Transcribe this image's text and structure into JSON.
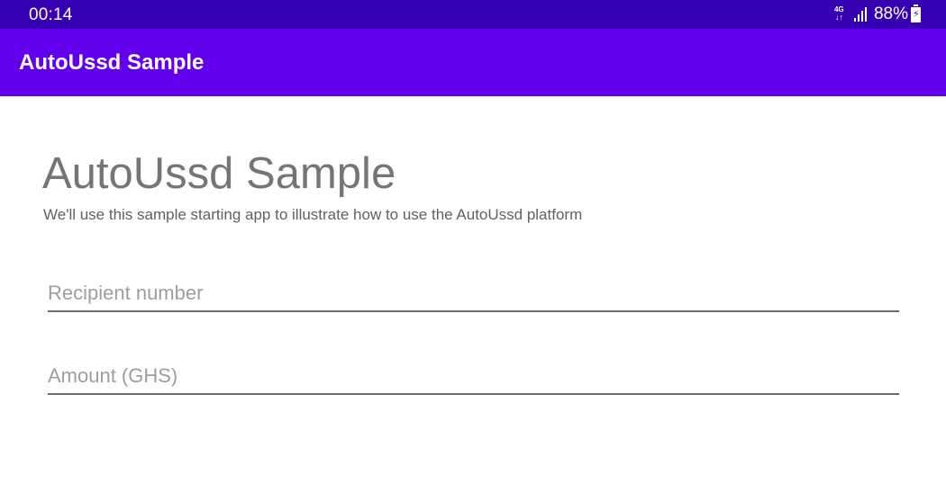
{
  "status_bar": {
    "time": "00:14",
    "network_type": "4G",
    "network_arrows": "↓↑",
    "battery_level": "88%",
    "icons": [
      "network-4g-icon",
      "signal-icon",
      "battery-charging-icon"
    ]
  },
  "app_bar": {
    "title": "AutoUssd Sample"
  },
  "main": {
    "title": "AutoUssd Sample",
    "subtitle": "We'll use this sample starting app to illustrate how to use the AutoUssd platform"
  },
  "form": {
    "recipient": {
      "placeholder": "Recipient number",
      "value": ""
    },
    "amount": {
      "placeholder": "Amount (GHS)",
      "value": ""
    }
  },
  "colors": {
    "status_bar": "#3700b3",
    "app_bar": "#6200ee"
  }
}
